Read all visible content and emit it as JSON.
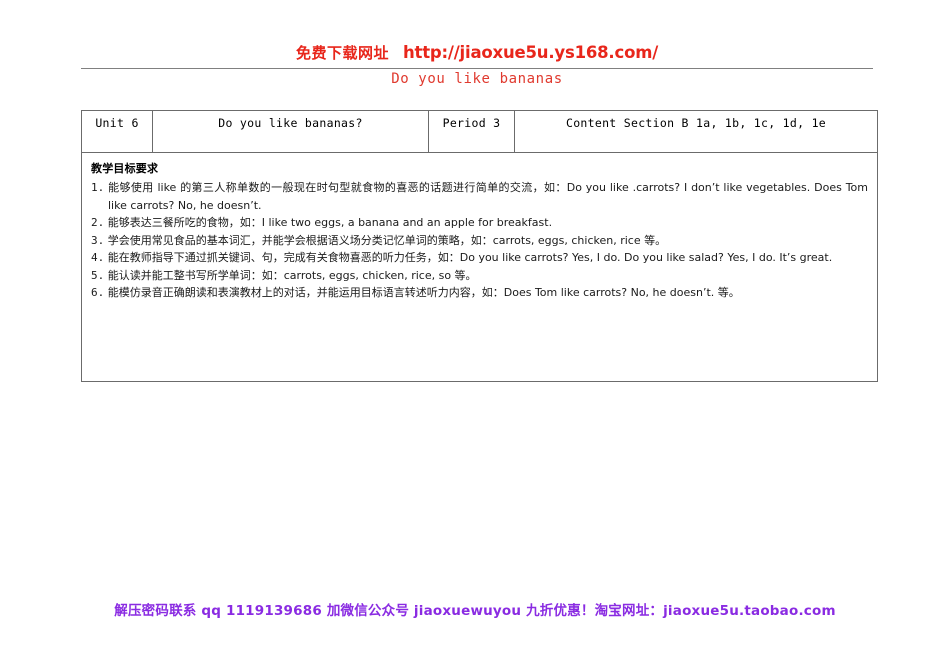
{
  "banner": {
    "label_cn": "免费下载网址",
    "url": "http://jiaoxue5u.ys168.com/",
    "color": "#e8261b"
  },
  "doc": {
    "title": "Do you like bananas",
    "title_color": "#e03a2f"
  },
  "table": {
    "headers": {
      "unit": "Unit 6",
      "lesson": "Do you like bananas?",
      "period": "Period 3",
      "content": "Content  Section B  1a, 1b, 1c, 1d, 1e"
    },
    "body": {
      "heading": "教学目标要求",
      "goals": [
        {
          "num": "1.",
          "text": "能够使用 like 的第三人称单数的一般现在时句型就食物的喜恶的话题进行简单的交流，如：Do you like .carrots? I don’t like vegetables. Does Tom like carrots? No, he doesn’t."
        },
        {
          "num": "2.",
          "text": "能够表达三餐所吃的食物，如：I like two eggs, a banana and an apple for breakfast."
        },
        {
          "num": "3.",
          "text": "学会使用常见食品的基本词汇，并能学会根据语义场分类记忆单词的策略，如：carrots, eggs, chicken, rice 等。"
        },
        {
          "num": "4.",
          "text": "能在教师指导下通过抓关键词、句，完成有关食物喜恶的听力任务，如：Do you like carrots? Yes, I do. Do you like salad? Yes, I do. It’s great."
        },
        {
          "num": "5.",
          "text": "能认读并能工整书写所学单词：如：carrots, eggs, chicken, rice, so 等。"
        },
        {
          "num": "6.",
          "text": "能模仿录音正确朗读和表演教材上的对话，并能运用目标语言转述听力内容，如：Does Tom like carrots? No, he doesn’t. 等。"
        }
      ]
    }
  },
  "footer": {
    "text": "解压密码联系 qq 1119139686  加微信公众号 jiaoxuewuyou  九折优惠！淘宝网址：jiaoxue5u.taobao.com",
    "color": "#8a2be2"
  }
}
